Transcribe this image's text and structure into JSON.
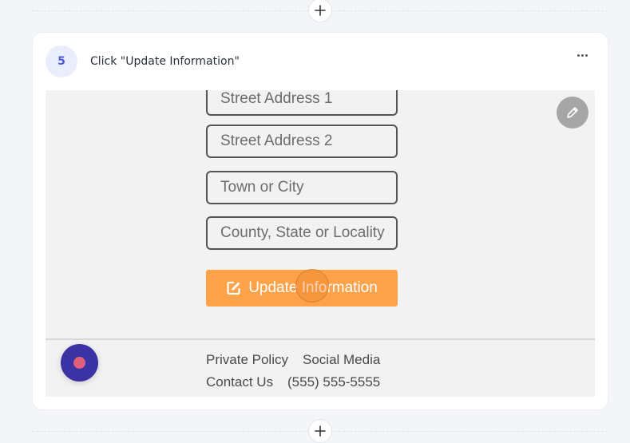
{
  "step": {
    "number": "5",
    "title": "Click \"Update Information\""
  },
  "form": {
    "fields": [
      "Street Address 1",
      "Street Address 2",
      "Town or City",
      "County, State or Locality"
    ],
    "update_button_label": "Update Information"
  },
  "footer": {
    "private_policy": "Private Policy",
    "social_media": "Social Media",
    "contact_us": "Contact Us",
    "phone": "(555) 555-5555"
  },
  "icons": {
    "add": "plus-icon",
    "more": "more-horizontal-icon",
    "edit": "pencil-icon",
    "update": "edit-square-icon",
    "record": "record-icon"
  },
  "colors": {
    "step_badge_bg": "#eaedfb",
    "step_badge_text": "#4b5bd6",
    "update_button_bg": "#ffa34a",
    "edit_fab_bg": "#a6a6a6",
    "record_button_bg": "#3b33a3",
    "record_dot": "#e0607b"
  }
}
